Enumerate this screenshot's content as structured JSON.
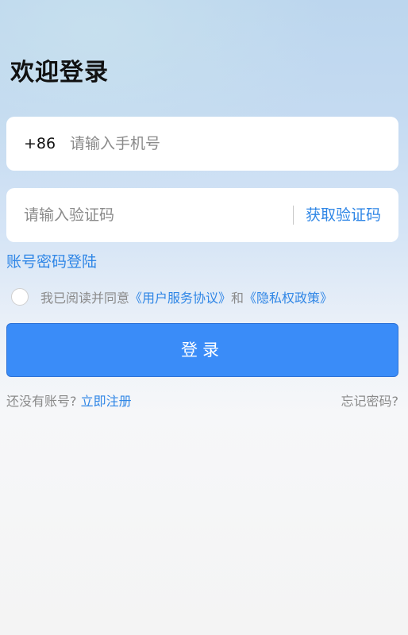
{
  "header": {
    "title": "欢迎登录"
  },
  "phone": {
    "prefix": "+86",
    "placeholder": "请输入手机号",
    "value": ""
  },
  "code": {
    "placeholder": "请输入验证码",
    "value": "",
    "get_code_label": "获取验证码"
  },
  "password_login_label": "账号密码登陆",
  "agreement": {
    "checked": false,
    "prefix": "我已阅读并同意",
    "user_agreement": "《用户服务协议》",
    "and": "和",
    "privacy_policy": "《隐私权政策》"
  },
  "login_button_label": "登录",
  "footer": {
    "no_account": "还没有账号?",
    "register_label": "立即注册",
    "forgot_label": "忘记密码?"
  },
  "colors": {
    "accent": "#3a8cf8",
    "link": "#2f86e6",
    "muted_text": "#8a8a8a"
  }
}
